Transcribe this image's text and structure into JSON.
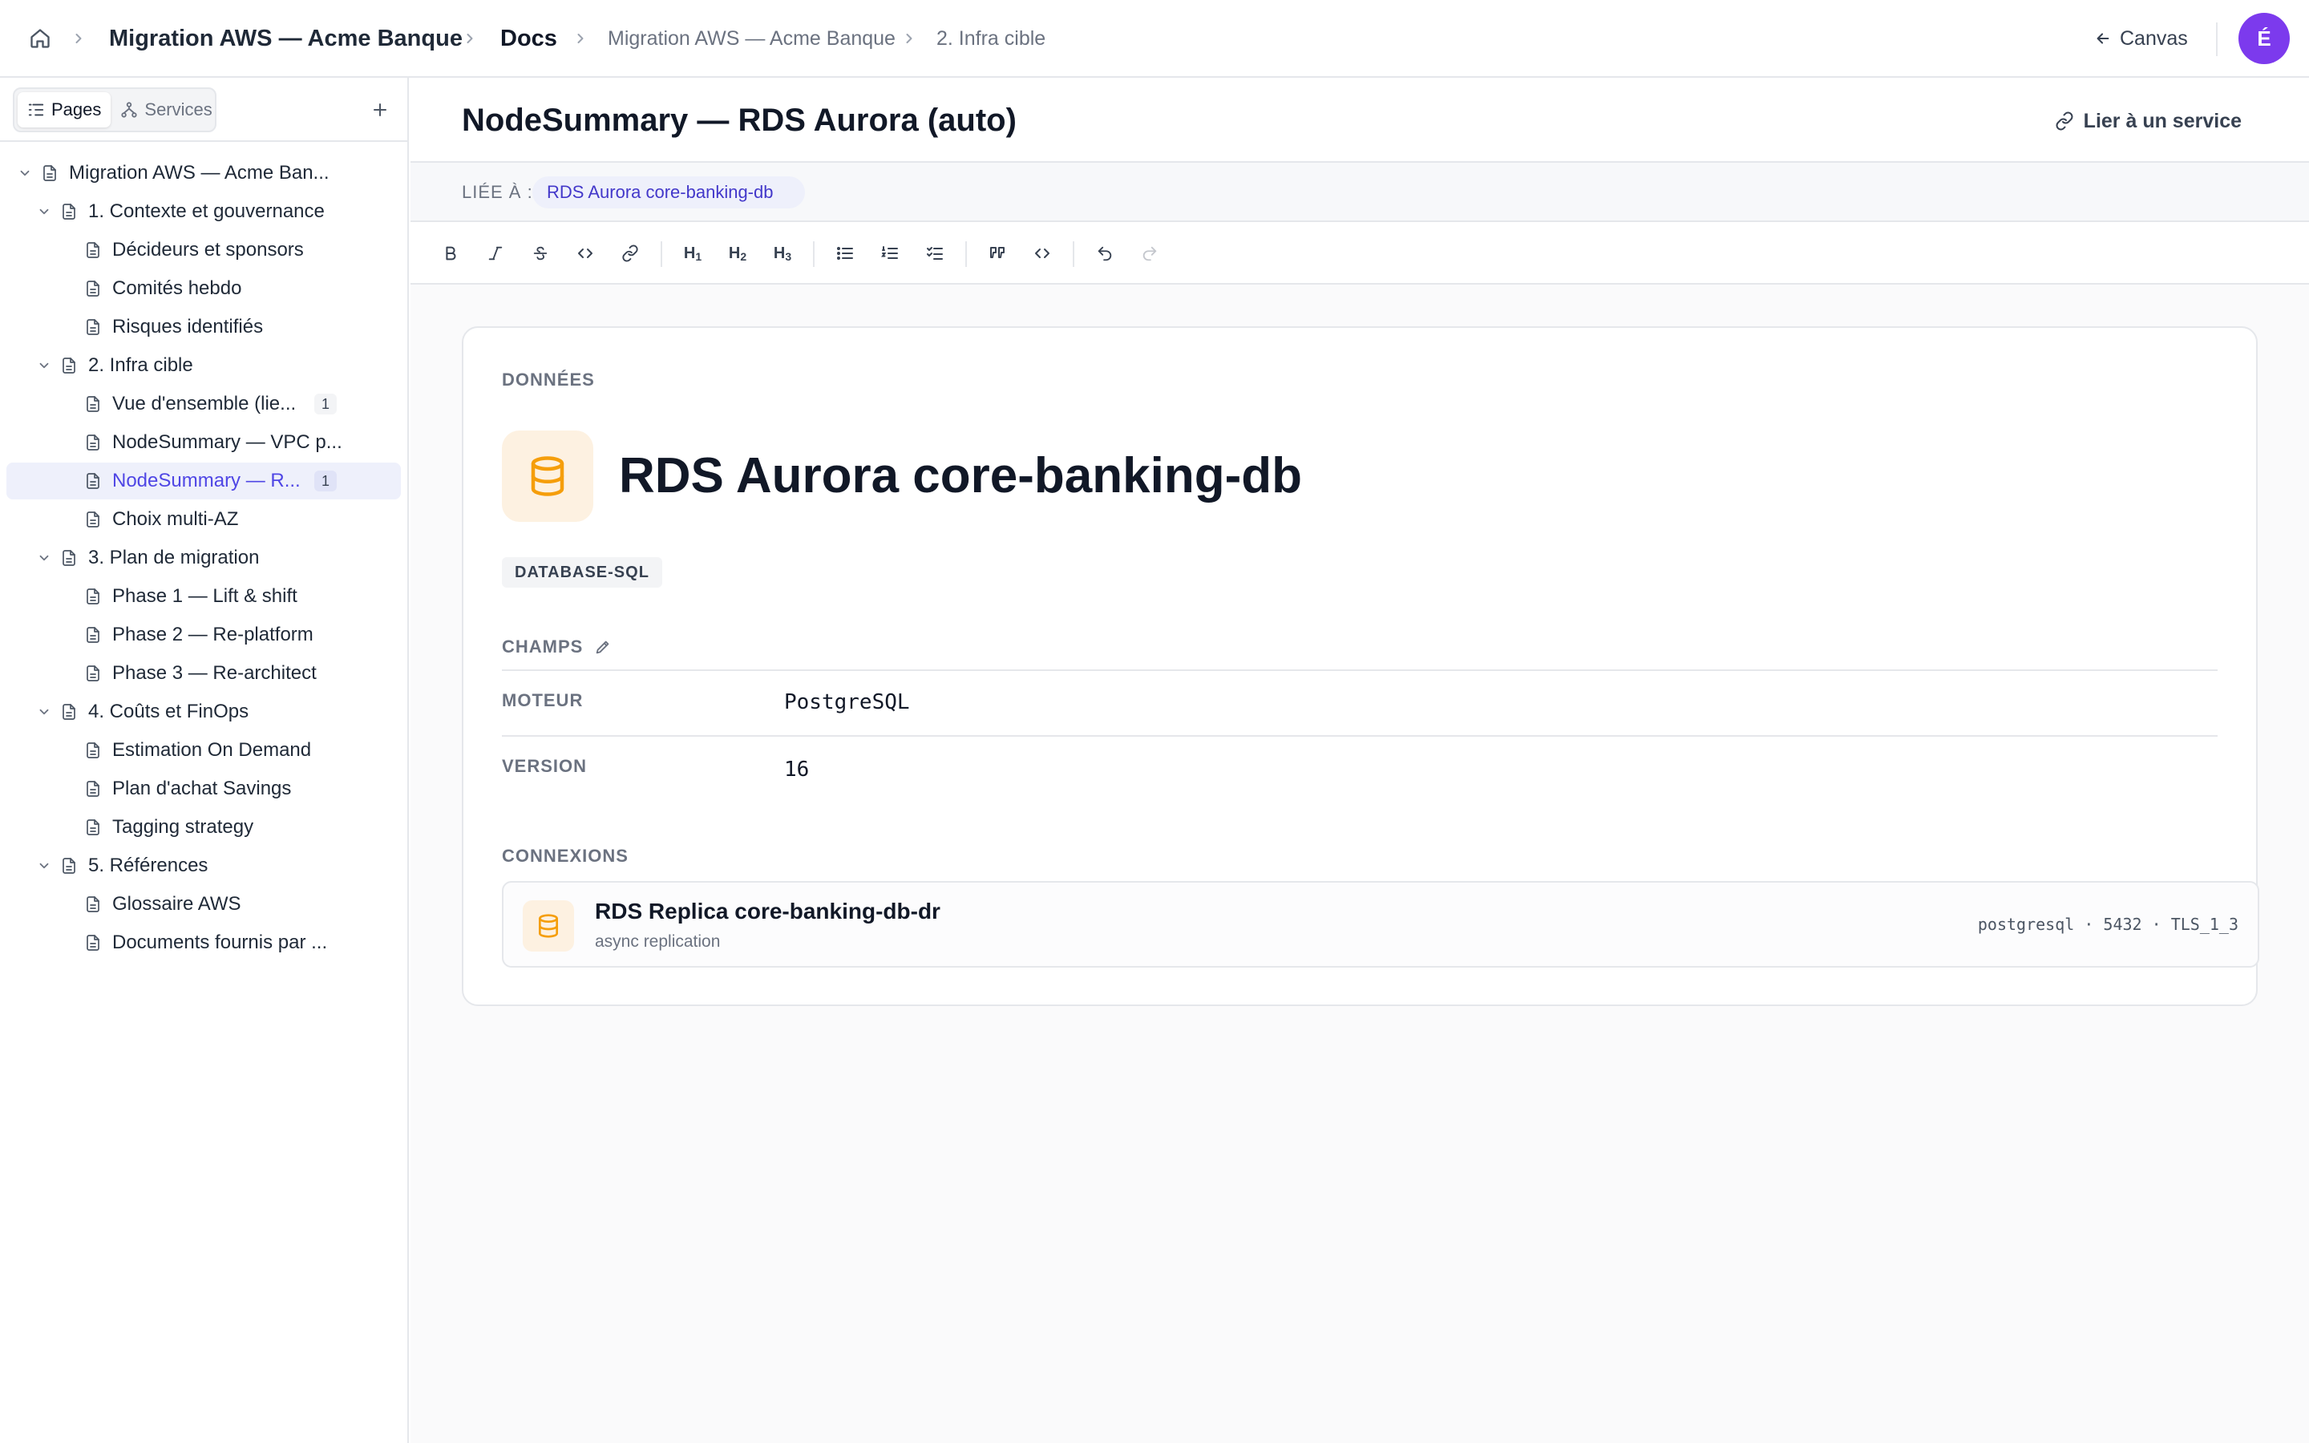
{
  "breadcrumb": {
    "project": "Migration AWS — Acme Banque",
    "section": "Docs",
    "page": "Migration AWS — Acme Banque",
    "subpage": "2. Infra cible"
  },
  "header": {
    "canvas_label": "Canvas",
    "avatar_initial": "É"
  },
  "sidebar": {
    "tabs": {
      "pages": "Pages",
      "services": "Services"
    },
    "tree": [
      {
        "label": "Migration AWS — Acme Ban...",
        "level": 0,
        "expanded": true
      },
      {
        "label": "1. Contexte et gouvernance",
        "level": 1,
        "expanded": true
      },
      {
        "label": "Décideurs et sponsors",
        "level": 2
      },
      {
        "label": "Comités hebdo",
        "level": 2
      },
      {
        "label": "Risques identifiés",
        "level": 2
      },
      {
        "label": "2. Infra cible",
        "level": 1,
        "expanded": true
      },
      {
        "label": "Vue d'ensemble (lie...",
        "level": 2,
        "count": "1"
      },
      {
        "label": "NodeSummary — VPC p...",
        "level": 2
      },
      {
        "label": "NodeSummary — R...",
        "level": 2,
        "count": "1",
        "active": true
      },
      {
        "label": "Choix multi-AZ",
        "level": 2
      },
      {
        "label": "3. Plan de migration",
        "level": 1,
        "expanded": true
      },
      {
        "label": "Phase 1 — Lift & shift",
        "level": 2
      },
      {
        "label": "Phase 2 — Re-platform",
        "level": 2
      },
      {
        "label": "Phase 3 — Re-architect",
        "level": 2
      },
      {
        "label": "4. Coûts et FinOps",
        "level": 1,
        "expanded": true
      },
      {
        "label": "Estimation On Demand",
        "level": 2
      },
      {
        "label": "Plan d'achat Savings",
        "level": 2
      },
      {
        "label": "Tagging strategy",
        "level": 2
      },
      {
        "label": "5. Références",
        "level": 1,
        "expanded": true
      },
      {
        "label": "Glossaire AWS",
        "level": 2
      },
      {
        "label": "Documents fournis par ...",
        "level": 2
      }
    ]
  },
  "page": {
    "title": "NodeSummary — RDS Aurora (auto)",
    "link_service_label": "Lier à un service",
    "linked_label": "LIÉE À :",
    "linked_chip": "RDS Aurora core-banking-db"
  },
  "card": {
    "category": "DONNÉES",
    "title": "RDS Aurora core-banking-db",
    "type_badge": "DATABASE-SQL",
    "fields_label": "CHAMPS",
    "fields": [
      {
        "key": "MOTEUR",
        "value": "PostgreSQL"
      },
      {
        "key": "VERSION",
        "value": "16"
      }
    ],
    "connections_label": "CONNEXIONS",
    "connection": {
      "title": "RDS Replica core-banking-db-dr",
      "subtitle": "async replication",
      "meta": "postgresql · 5432 · TLS_1_3"
    }
  },
  "colors": {
    "accent": "#4f46e5",
    "avatar": "#7c3aed",
    "db_icon": "#f59e0b",
    "db_icon_bg": "#fdf1e1"
  },
  "icons": {
    "home": "home-icon",
    "database": "database-icon",
    "document": "document-icon",
    "link": "link-icon",
    "arrow_left": "arrow-left-icon"
  }
}
